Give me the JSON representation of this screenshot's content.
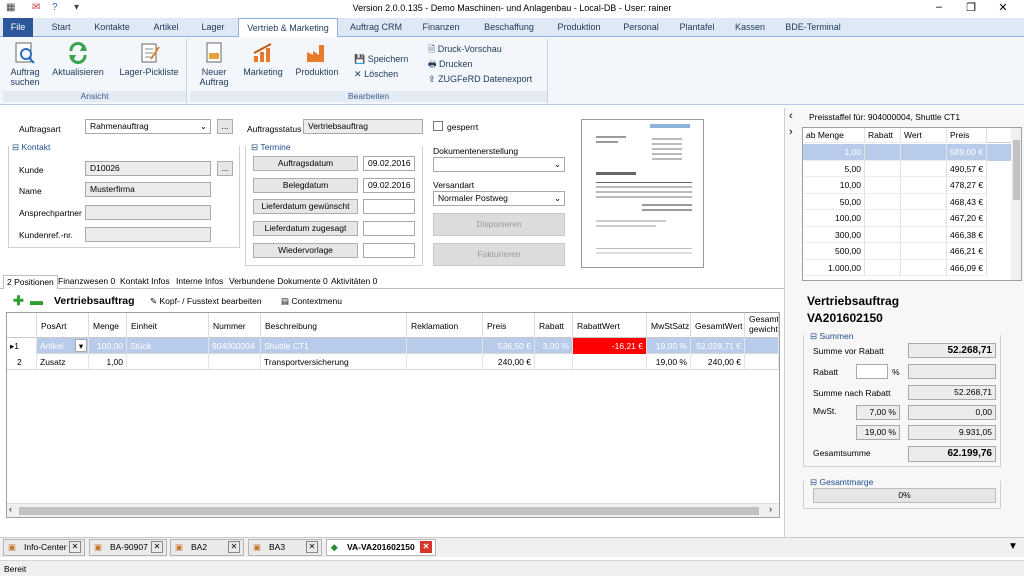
{
  "window": {
    "title": "Version 2.0.0.135 - Demo Maschinen- und Anlagenbau - Local-DB - User: rainer"
  },
  "ribbon_tabs": [
    "File",
    "Start",
    "Kontakte",
    "Artikel",
    "Lager",
    "Vertrieb & Marketing",
    "Auftrag CRM",
    "Finanzen",
    "Beschaffung",
    "Produktion",
    "Personal",
    "Plantafel",
    "Kassen",
    "BDE-Terminal"
  ],
  "ribbon": {
    "auftrag_suchen": "Auftrag suchen",
    "aktualisieren": "Aktualisieren",
    "lager_pickliste": "Lager-Pickliste",
    "group_ansicht": "Ansicht",
    "neuer_auftrag": "Neuer Auftrag",
    "marketing": "Marketing",
    "produktion": "Produktion",
    "speichern": "Speichern",
    "loeschen": "Löschen",
    "group_bearbeiten": "Bearbeiten",
    "druck_vorschau": "Druck-Vorschau",
    "drucken": "Drucken",
    "zugferd": "ZUGFeRD Datenexport"
  },
  "form": {
    "auftragsart_label": "Auftragsart",
    "auftragsart": "Rahmenauftrag",
    "auftragsstatus_label": "Auftragsstatus",
    "auftragsstatus": "Vertriebsauftrag",
    "gesperrt": "gesperrt",
    "kontakt_group": "Kontakt",
    "kunde_label": "Kunde",
    "kunde": "D10026",
    "name_label": "Name",
    "name": "Musterfirma",
    "ansprechpartner_label": "Ansprechpartner",
    "kundenref_label": "Kundenref.-nr.",
    "termine_group": "Termine",
    "auftragsdatum": "Auftragsdatum",
    "auftragsdatum_val": "09.02.2016",
    "belegdatum": "Belegdatum",
    "belegdatum_val": "09.02.2016",
    "lieferdatum_gew": "Lieferdatum gewünscht",
    "lieferdatum_zug": "Lieferdatum zugesagt",
    "wiedervorlage": "Wiedervorlage",
    "dokumentenerstellung_label": "Dokumentenerstellung",
    "versandart_label": "Versandart",
    "versandart": "Normaler Postweg",
    "disponieren": "Disponieren",
    "fakturieren": "Fakturieren",
    "browse": "..."
  },
  "pos_tabs": [
    "2 Positionen",
    "Finanzwesen 0",
    "Kontakt Infos",
    "Interne Infos",
    "Verbundene Dokumente 0",
    "Aktivitäten 0"
  ],
  "pos_toolbar": {
    "title": "Vertriebsauftrag",
    "kopf": "Kopf- / Fusstext bearbeiten",
    "context": "Contextmenu"
  },
  "grid": {
    "headers": [
      "PosArt",
      "Menge",
      "Einheit",
      "Nummer",
      "Beschreibung",
      "Reklamation",
      "Preis",
      "Rabatt",
      "RabattWert",
      "MwStSatz",
      "GesamtWert",
      "Gesamt-gewicht"
    ],
    "rows": [
      {
        "n": "1",
        "posart": "Artikel",
        "menge": "100,00",
        "einheit": "Stück",
        "nummer": "904000004",
        "beschreibung": "Shuttle CT1",
        "reklamation": "",
        "preis": "536,50 €",
        "rabatt": "3,00 %",
        "rabattwert": "-16,21 €",
        "mwst": "19,00 %",
        "gesamt": "52.028,71 €",
        "gewicht": ""
      },
      {
        "n": "2",
        "posart": "Zusatz",
        "menge": "1,00",
        "einheit": "",
        "nummer": "",
        "beschreibung": "Transportversicherung",
        "reklamation": "",
        "preis": "240,00 €",
        "rabatt": "",
        "rabattwert": "",
        "mwst": "19,00 %",
        "gesamt": "240,00 €",
        "gewicht": ""
      }
    ]
  },
  "preisstaffel": {
    "title": "Preisstaffel für: 904000004, Shuttle CT1",
    "headers": [
      "ab Menge",
      "Rabatt",
      "Wert",
      "Preis"
    ],
    "rows": [
      [
        "1,00",
        "589,00 €"
      ],
      [
        "5,00",
        "490,57 €"
      ],
      [
        "10,00",
        "478,27 €"
      ],
      [
        "50,00",
        "468,43 €"
      ],
      [
        "100,00",
        "467,20 €"
      ],
      [
        "300,00",
        "466,38 €"
      ],
      [
        "500,00",
        "466,21 €"
      ],
      [
        "1.000,00",
        "466,09 €"
      ]
    ]
  },
  "summary": {
    "doc_type": "Vertriebsauftrag",
    "doc_no": "VA201602150",
    "summen": "Summen",
    "summe_vor_rabatt_label": "Summe vor Rabatt",
    "summe_vor_rabatt": "52.268,71",
    "rabatt_label": "Rabatt",
    "pct": "%",
    "summe_nach_rabatt_label": "Summe nach Rabatt",
    "summe_nach_rabatt": "52.268,71",
    "mwst_label": "MwSt.",
    "mwst1_rate": "7,00 %",
    "mwst1": "0,00",
    "mwst2_rate": "19,00 %",
    "mwst2": "9.931,05",
    "gesamtsumme_label": "Gesamtsumme",
    "gesamtsumme": "62.199,76",
    "gesamtmarge": "Gesamtmarge",
    "marge": "0%"
  },
  "bottom_tabs": [
    "Info-Center",
    "BA-90907",
    "BA2",
    "BA3",
    "VA-VA201602150"
  ],
  "status": "Bereit"
}
